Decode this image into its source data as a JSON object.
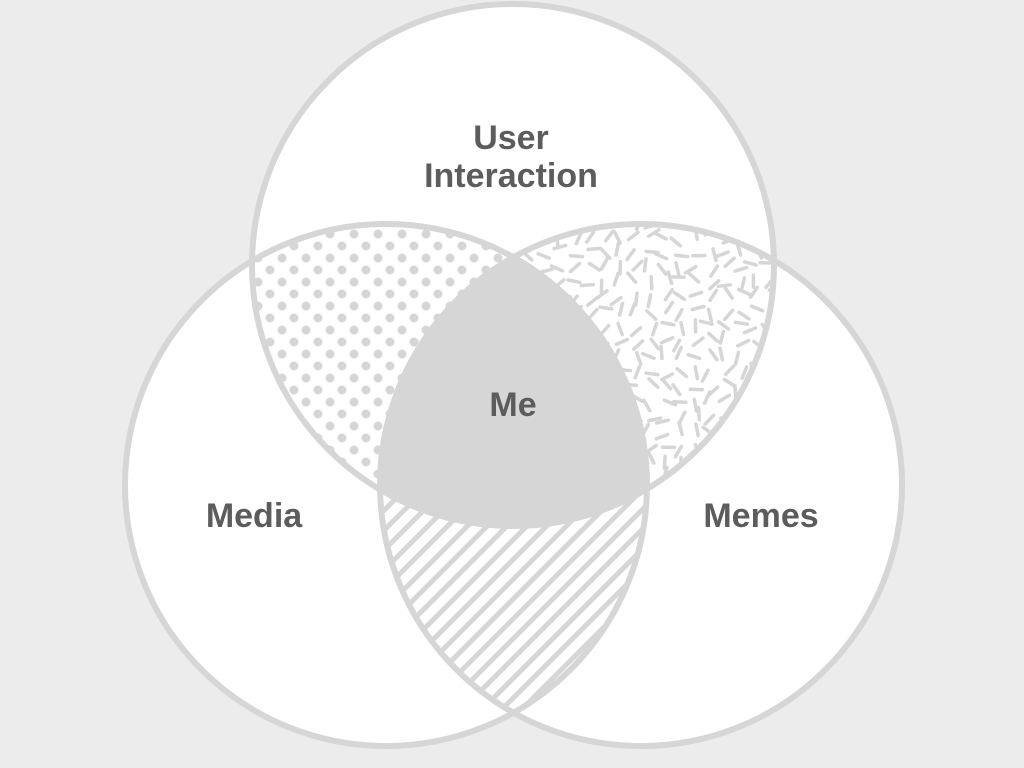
{
  "diagram": {
    "type": "venn-3",
    "sets": [
      {
        "key": "top",
        "label_lines": [
          "User",
          "Interaction"
        ]
      },
      {
        "key": "left",
        "label_lines": [
          "Media"
        ]
      },
      {
        "key": "right",
        "label_lines": [
          "Memes"
        ]
      }
    ],
    "center_label": "Me",
    "overlap_fills": {
      "top_left": "dots",
      "top_right": "dashes",
      "left_right": "diagonal-stripes",
      "all_three": "solid"
    }
  },
  "colors": {
    "background": "#ececec",
    "circle_fill": "#ffffff",
    "circle_stroke": "#d6d6d6",
    "pattern": "#d6d6d6",
    "center_fill": "#d6d6d6",
    "text": "#5c5c5c"
  }
}
